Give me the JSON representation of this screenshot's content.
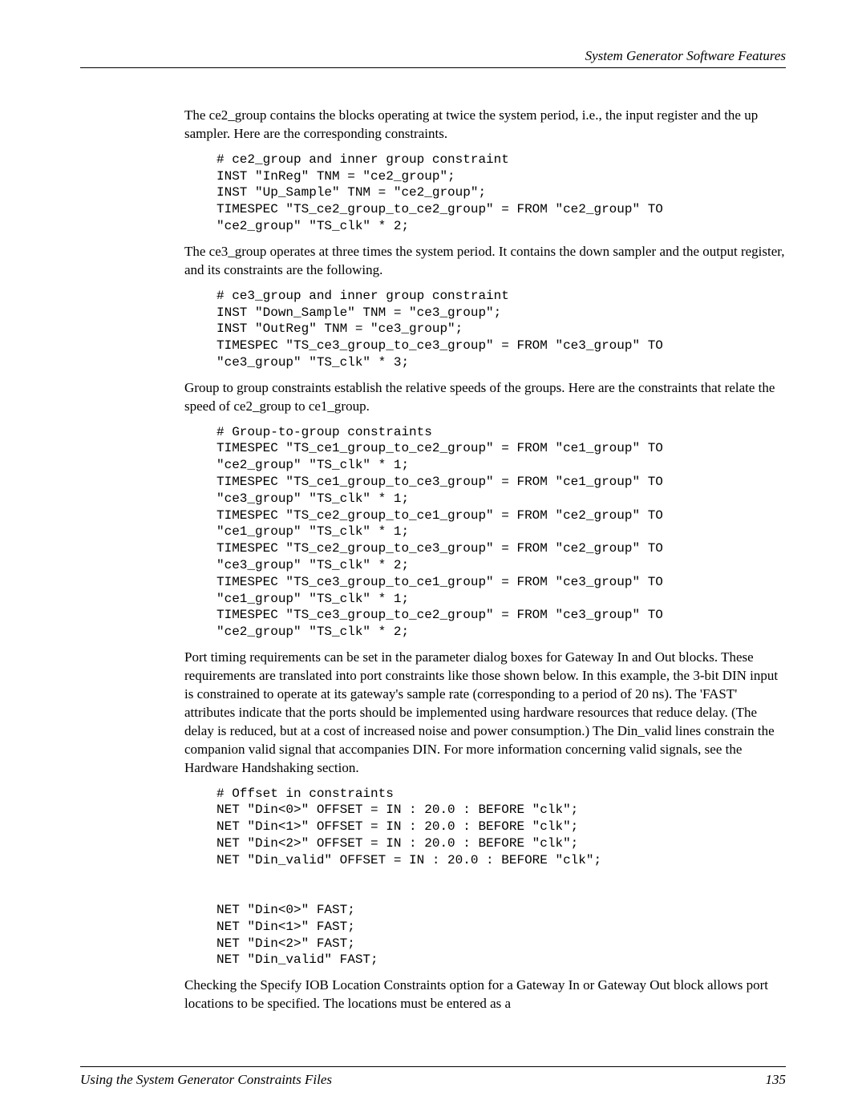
{
  "header": {
    "title": "System Generator Software Features"
  },
  "content": {
    "para1": "The ce2_group contains the blocks operating at twice the system period, i.e., the input register and the up sampler.  Here are the corresponding constraints.",
    "code1": "# ce2_group and inner group constraint\nINST \"InReg\" TNM = \"ce2_group\";\nINST \"Up_Sample\" TNM = \"ce2_group\";\nTIMESPEC \"TS_ce2_group_to_ce2_group\" = FROM \"ce2_group\" TO\n\"ce2_group\" \"TS_clk\" * 2;",
    "para2": "The ce3_group  operates at three times the system period.  It contains the down sampler and the output register, and its constraints are the following.",
    "code2": "# ce3_group and inner group constraint\nINST \"Down_Sample\" TNM = \"ce3_group\";\nINST \"OutReg\" TNM = \"ce3_group\";\nTIMESPEC \"TS_ce3_group_to_ce3_group\" = FROM \"ce3_group\" TO\n\"ce3_group\" \"TS_clk\" * 3;",
    "para3": "Group to group constraints establish the relative speeds of the groups.  Here are the constraints that relate the speed of ce2_group to ce1_group.",
    "code3": "# Group-to-group constraints\nTIMESPEC \"TS_ce1_group_to_ce2_group\" = FROM \"ce1_group\" TO\n\"ce2_group\" \"TS_clk\" * 1;\nTIMESPEC \"TS_ce1_group_to_ce3_group\" = FROM \"ce1_group\" TO\n\"ce3_group\" \"TS_clk\" * 1;\nTIMESPEC \"TS_ce2_group_to_ce1_group\" = FROM \"ce2_group\" TO\n\"ce1_group\" \"TS_clk\" * 1;\nTIMESPEC \"TS_ce2_group_to_ce3_group\" = FROM \"ce2_group\" TO\n\"ce3_group\" \"TS_clk\" * 2;\nTIMESPEC \"TS_ce3_group_to_ce1_group\" = FROM \"ce3_group\" TO\n\"ce1_group\" \"TS_clk\" * 1;\nTIMESPEC \"TS_ce3_group_to_ce2_group\" = FROM \"ce3_group\" TO\n\"ce2_group\" \"TS_clk\" * 2;",
    "para4": "Port timing requirements can be set in the parameter dialog boxes for Gateway In and Out blocks.  These requirements are translated into port constraints like those shown below.  In this example, the 3-bit DIN input is constrained to operate at its gateway's sample rate (corresponding to a period of 20 ns).  The 'FAST' attributes indicate that the ports should be implemented using hardware resources that reduce delay.  (The delay is reduced, but at a cost of increased noise and power consumption.)  The Din_valid lines constrain the companion valid signal that accompanies DIN.  For more information concerning valid signals, see the Hardware Handshaking section.",
    "code4": "# Offset in constraints\nNET \"Din<0>\" OFFSET = IN : 20.0 : BEFORE \"clk\";\nNET \"Din<1>\" OFFSET = IN : 20.0 : BEFORE \"clk\";\nNET \"Din<2>\" OFFSET = IN : 20.0 : BEFORE \"clk\";\nNET \"Din_valid\" OFFSET = IN : 20.0 : BEFORE \"clk\";\n\n\nNET \"Din<0>\" FAST;\nNET \"Din<1>\" FAST;\nNET \"Din<2>\" FAST;\nNET \"Din_valid\" FAST;",
    "para5": "Checking the  Specify IOB Location Constraints option for a  Gateway In or Gateway Out block allows port  locations to be specified.  The locations must be entered  as a"
  },
  "footer": {
    "left": "Using the System Generator Constraints Files",
    "page": "135"
  }
}
